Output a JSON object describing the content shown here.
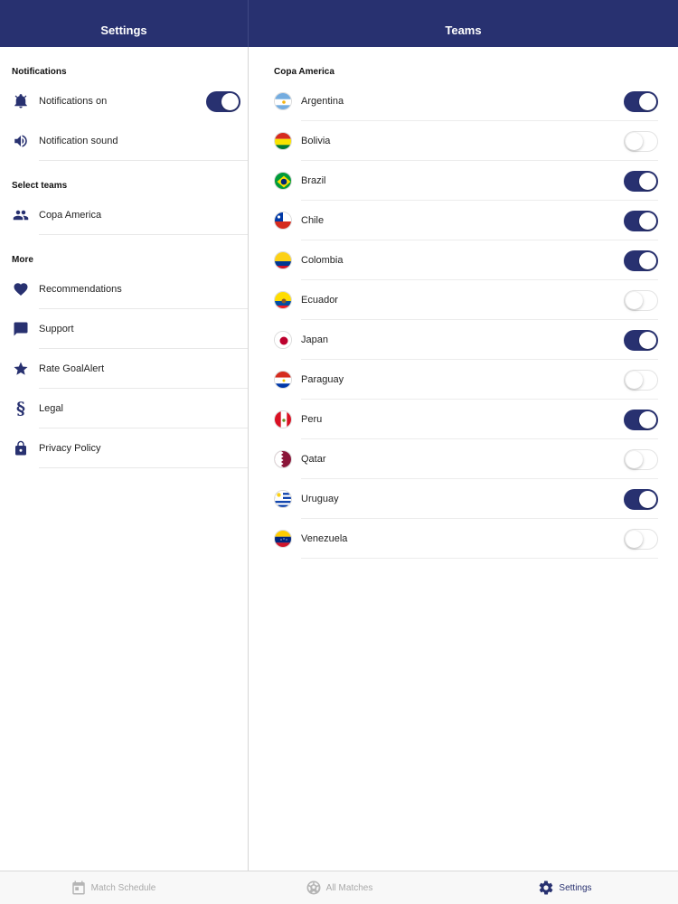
{
  "header": {
    "left_title": "Settings",
    "right_title": "Teams"
  },
  "colors": {
    "primary": "#283170",
    "toggle_off": "#ffffff",
    "divider": "#e8e8e8"
  },
  "settings": {
    "notifications_heading": "Notifications",
    "notifications_on": {
      "label": "Notifications on",
      "icon": "bell-icon",
      "enabled": true
    },
    "notification_sound": {
      "label": "Notification sound",
      "icon": "speaker-icon"
    },
    "select_teams_heading": "Select teams",
    "copa_america": {
      "label": "Copa America",
      "icon": "people-icon"
    },
    "more_heading": "More",
    "more_items": [
      {
        "label": "Recommendations",
        "icon": "heart-icon"
      },
      {
        "label": "Support",
        "icon": "chat-icon"
      },
      {
        "label": "Rate GoalAlert",
        "icon": "star-icon"
      },
      {
        "label": "Legal",
        "icon": "section-icon"
      },
      {
        "label": "Privacy Policy",
        "icon": "lock-icon"
      }
    ]
  },
  "teams": {
    "heading": "Copa America",
    "list": [
      {
        "name": "Argentina",
        "enabled": true
      },
      {
        "name": "Bolivia",
        "enabled": false
      },
      {
        "name": "Brazil",
        "enabled": true
      },
      {
        "name": "Chile",
        "enabled": true
      },
      {
        "name": "Colombia",
        "enabled": true
      },
      {
        "name": "Ecuador",
        "enabled": false
      },
      {
        "name": "Japan",
        "enabled": true
      },
      {
        "name": "Paraguay",
        "enabled": false
      },
      {
        "name": "Peru",
        "enabled": true
      },
      {
        "name": "Qatar",
        "enabled": false
      },
      {
        "name": "Uruguay",
        "enabled": true
      },
      {
        "name": "Venezuela",
        "enabled": false
      }
    ]
  },
  "tabbar": {
    "tabs": [
      {
        "label": "Match Schedule",
        "icon": "calendar-icon",
        "active": false
      },
      {
        "label": "All Matches",
        "icon": "soccer-ball-icon",
        "active": false
      },
      {
        "label": "Settings",
        "icon": "gear-icon",
        "active": true
      }
    ]
  }
}
